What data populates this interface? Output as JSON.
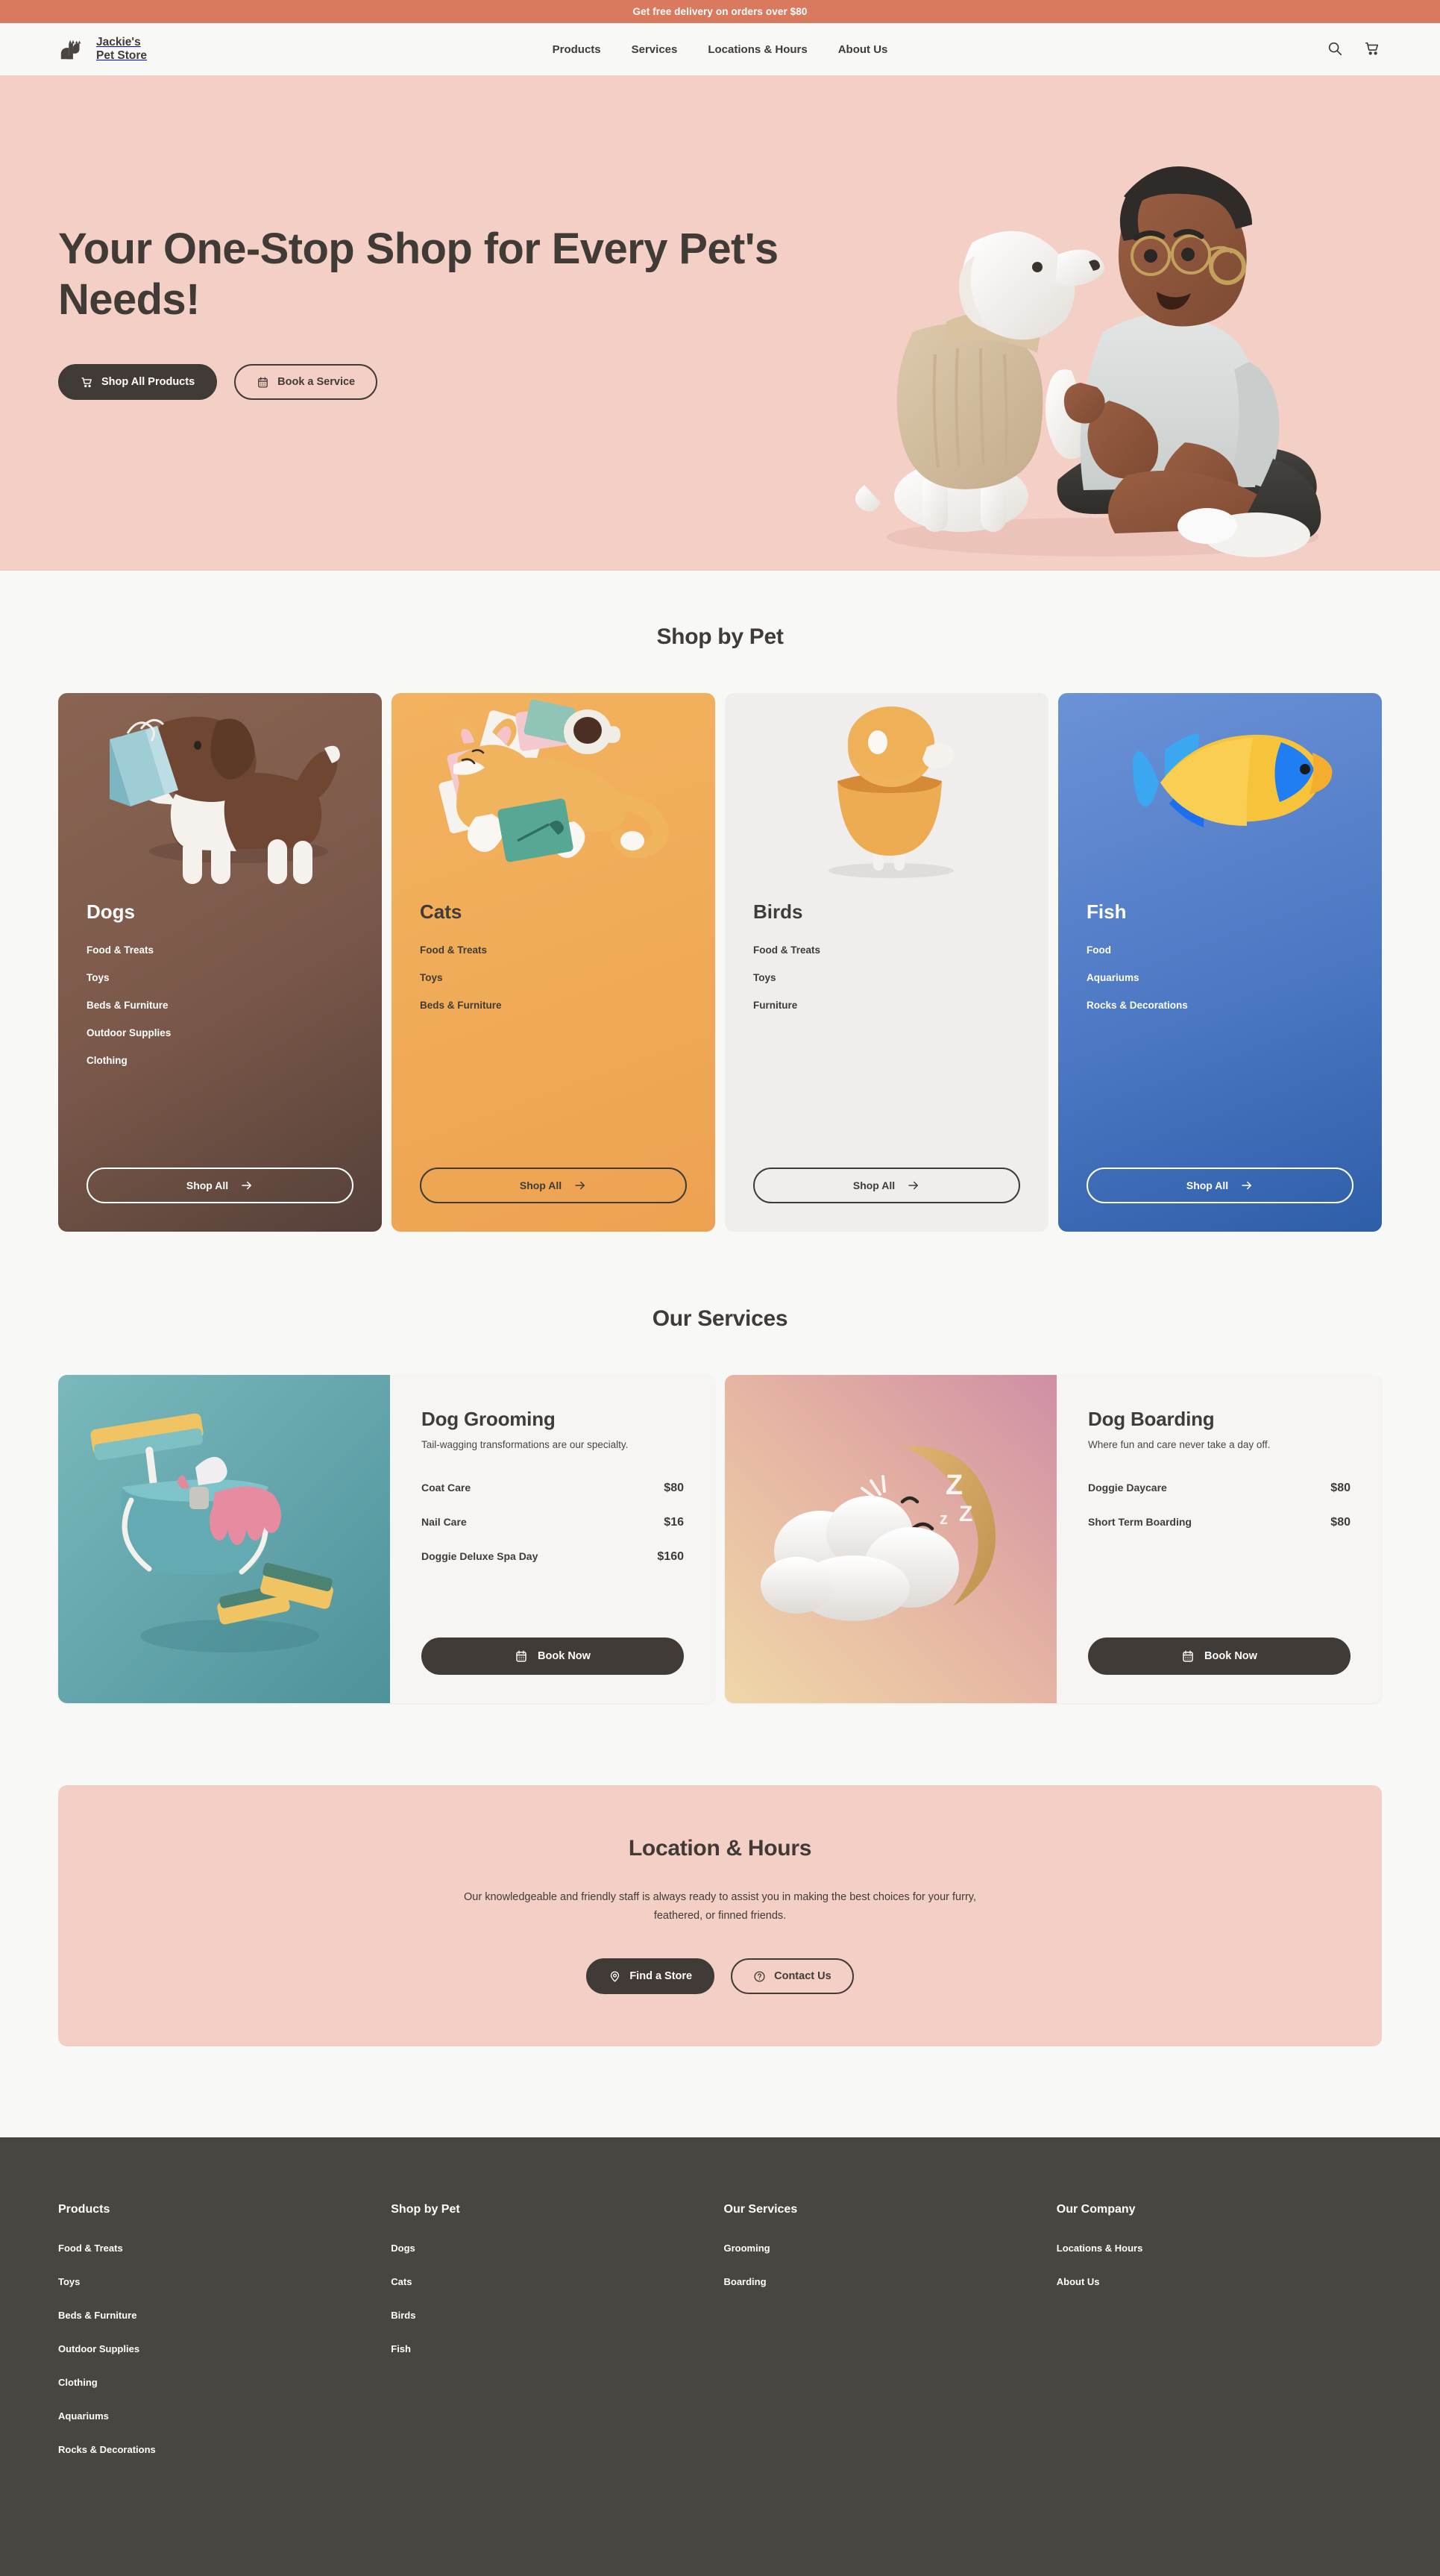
{
  "promo": {
    "text": "Get free delivery on orders over $80"
  },
  "header": {
    "brand": "Jackie's\nPet Store",
    "nav": [
      {
        "label": "Products"
      },
      {
        "label": "Services"
      },
      {
        "label": "Locations & Hours"
      },
      {
        "label": "About Us"
      }
    ],
    "search_icon": "search-icon",
    "cart_icon": "shopping-cart-icon"
  },
  "hero": {
    "title": "Your One-Stop Shop for Every Pet's Needs!",
    "primary_button": {
      "label": "Shop All Products",
      "icon": "shopping-cart-icon"
    },
    "secondary_button": {
      "label": "Book a Service",
      "icon": "calendar-icon"
    },
    "image_alt": "3d illustration of a person sitting with a dog in a sweater"
  },
  "shop_by_pet": {
    "title": "Shop by Pet",
    "shop_all_label": "Shop All",
    "cards": [
      {
        "name": "Dogs",
        "image_alt": "3d dog carrying a blue shopping bag",
        "links": [
          "Food & Treats",
          "Toys",
          "Beds & Furniture",
          "Outdoor Supplies",
          "Clothing"
        ]
      },
      {
        "name": "Cats",
        "image_alt": "3d orange cat lying on papers with a coffee cup",
        "links": [
          "Food & Treats",
          "Toys",
          "Beds & Furniture"
        ]
      },
      {
        "name": "Birds",
        "image_alt": "3d stylized orange bird",
        "links": [
          "Food & Treats",
          "Toys",
          "Furniture"
        ]
      },
      {
        "name": "Fish",
        "image_alt": "3d yellow and blue tropical fish",
        "links": [
          "Food",
          "Aquariums",
          "Rocks & Decorations"
        ]
      }
    ]
  },
  "services": {
    "title": "Our Services",
    "book_label": "Book Now",
    "cards": [
      {
        "title": "Dog Grooming",
        "subtitle": "Tail-wagging transformations are our specialty.",
        "image_alt": "3d teal cleaning bucket with squeegee, spray bottle, gloves and sponges",
        "prices": [
          {
            "name": "Coat Care",
            "value": "$80"
          },
          {
            "name": "Nail Care",
            "value": "$16"
          },
          {
            "name": "Doggie Deluxe Spa Day",
            "value": "$160"
          }
        ]
      },
      {
        "title": "Dog Boarding",
        "subtitle": "Where fun and care never take a day off.",
        "image_alt": "3d sleeping crescent moon behind a white cloud with Zzz",
        "prices": [
          {
            "name": "Doggie Daycare",
            "value": "$80"
          },
          {
            "name": "Short Term Boarding",
            "value": "$80"
          }
        ]
      }
    ]
  },
  "location": {
    "title": "Location & Hours",
    "text": "Our knowledgeable and friendly staff is always ready to assist you in making the best choices for your furry, feathered, or finned friends.",
    "primary_button": {
      "label": "Find a Store",
      "icon": "map-pin-icon"
    },
    "secondary_button": {
      "label": "Contact Us",
      "icon": "question-mark-icon"
    }
  },
  "footer": {
    "columns": [
      {
        "title": "Products",
        "links": [
          "Food & Treats",
          "Toys",
          "Beds & Furniture",
          "Outdoor Supplies",
          "Clothing",
          "Aquariums",
          "Rocks & Decorations"
        ]
      },
      {
        "title": "Shop by Pet",
        "links": [
          "Dogs",
          "Cats",
          "Birds",
          "Fish"
        ]
      },
      {
        "title": "Our Services",
        "links": [
          "Grooming",
          "Boarding"
        ]
      },
      {
        "title": "Our Company",
        "links": [
          "Locations & Hours",
          "About Us"
        ]
      }
    ]
  },
  "colors": {
    "promo_bg": "#d9795d",
    "hero_bg": "#f4cfc5",
    "dark": "#403b37",
    "page_bg": "#f8f8f7",
    "footer_bg": "#494540",
    "dogs_card": "#7a5849",
    "cats_card": "#f0ab58",
    "birds_card": "#efeeec",
    "fish_card": "#4c78c4"
  }
}
